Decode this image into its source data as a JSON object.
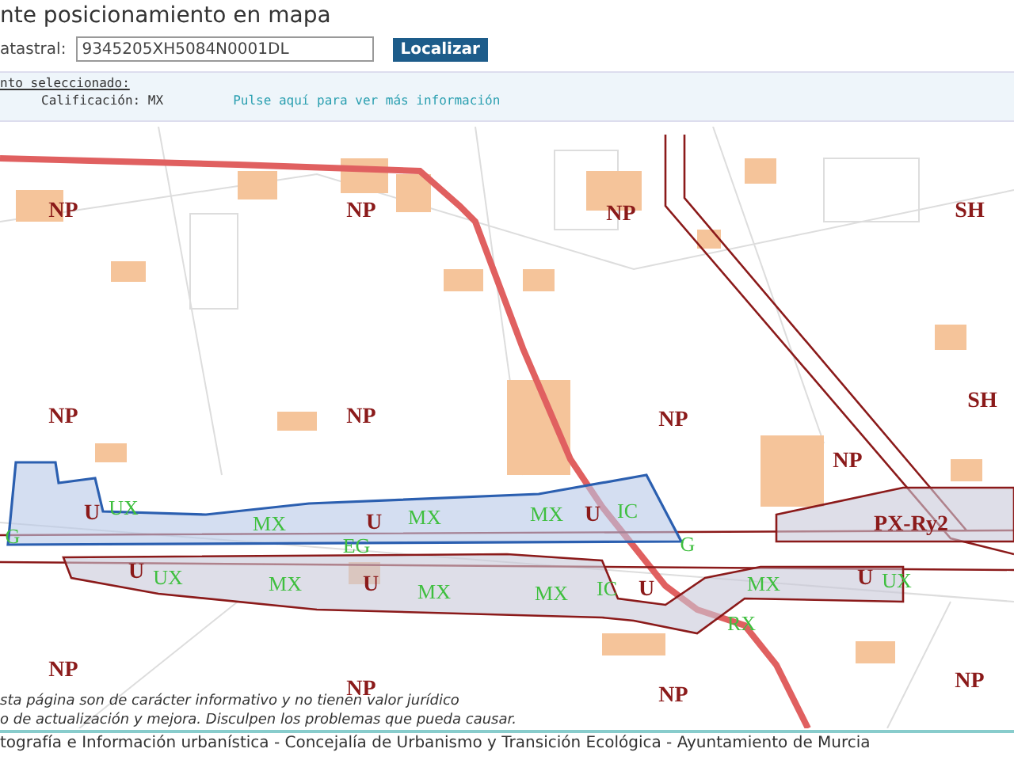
{
  "header": {
    "title": "nte posicionamiento en mapa",
    "field_label": "atastral:",
    "field_value": "9345205XH5084N0001DL",
    "button": "Localizar"
  },
  "info": {
    "heading": "nto seleccionado:",
    "classification": "Calificación: MX",
    "link": "Pulse aquí para ver más información"
  },
  "map": {
    "labels": [
      {
        "text": "NP",
        "kind": "zone"
      },
      {
        "text": "NP",
        "kind": "zone"
      },
      {
        "text": "NP",
        "kind": "zone"
      },
      {
        "text": "SH",
        "kind": "zone"
      },
      {
        "text": "SH",
        "kind": "zone"
      },
      {
        "text": "NP",
        "kind": "zone"
      },
      {
        "text": "NP",
        "kind": "zone"
      },
      {
        "text": "NP",
        "kind": "zone"
      },
      {
        "text": "NP",
        "kind": "zone"
      },
      {
        "text": "U",
        "kind": "zone"
      },
      {
        "text": "UX",
        "kind": "use"
      },
      {
        "text": "MX",
        "kind": "use"
      },
      {
        "text": "U",
        "kind": "zone"
      },
      {
        "text": "MX",
        "kind": "use"
      },
      {
        "text": "MX",
        "kind": "use"
      },
      {
        "text": "U",
        "kind": "zone"
      },
      {
        "text": "IC",
        "kind": "use"
      },
      {
        "text": "G",
        "kind": "use"
      },
      {
        "text": "EG",
        "kind": "use"
      },
      {
        "text": "G",
        "kind": "use"
      },
      {
        "text": "PX-Ry2",
        "kind": "zone"
      },
      {
        "text": "U",
        "kind": "zone"
      },
      {
        "text": "UX",
        "kind": "use"
      },
      {
        "text": "MX",
        "kind": "use"
      },
      {
        "text": "U",
        "kind": "zone"
      },
      {
        "text": "MX",
        "kind": "use"
      },
      {
        "text": "MX",
        "kind": "use"
      },
      {
        "text": "IC",
        "kind": "use"
      },
      {
        "text": "U",
        "kind": "zone"
      },
      {
        "text": "MX",
        "kind": "use"
      },
      {
        "text": "U",
        "kind": "zone"
      },
      {
        "text": "UX",
        "kind": "use"
      },
      {
        "text": "RX",
        "kind": "use"
      },
      {
        "text": "NP",
        "kind": "zone"
      },
      {
        "text": "NP",
        "kind": "zone"
      },
      {
        "text": "NP",
        "kind": "zone"
      },
      {
        "text": "NP",
        "kind": "zone"
      }
    ],
    "disclaimer": [
      "sta página son de carácter informativo y no tienen valor jurídico",
      "o de actualización y mejora. Disculpen los problemas que pueda causar."
    ]
  },
  "footer": "tografía e Información urbanística - Concejalía de Urbanismo y Transición Ecológica - Ayuntamiento de Murcia"
}
